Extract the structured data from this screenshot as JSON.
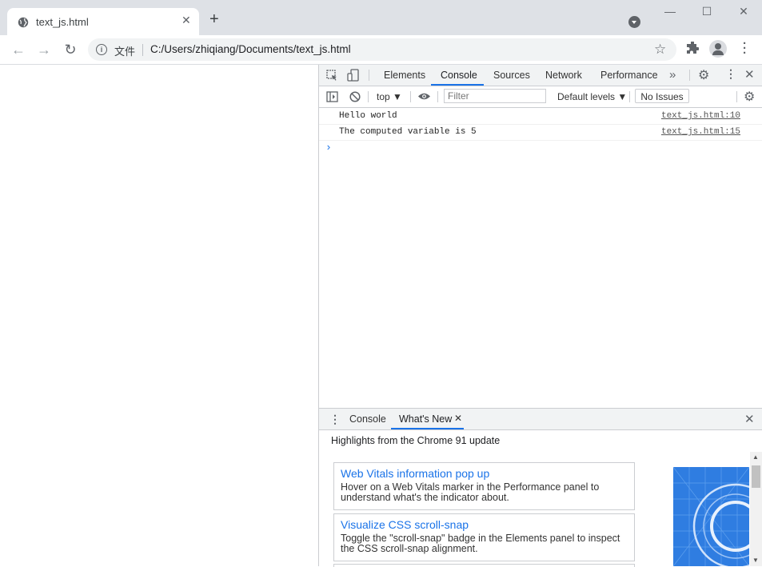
{
  "browser": {
    "tab_title": "text_js.html",
    "tab_close": "✕",
    "new_tab": "+",
    "window_controls": {
      "minimize": "—",
      "maximize": "☐",
      "close": "✕"
    },
    "omnibox": {
      "chip": "文件",
      "url": "C:/Users/zhiqiang/Documents/text_js.html"
    }
  },
  "devtools": {
    "tabs": [
      "Elements",
      "Console",
      "Sources",
      "Network",
      "Performance"
    ],
    "more_tabs": "»",
    "active_tab": "Console",
    "console_toolbar": {
      "context": "top ▼",
      "filter_placeholder": "Filter",
      "levels": "Default levels ▼",
      "issues": "No Issues"
    },
    "messages": [
      {
        "text": "Hello world",
        "source": "text_js.html:10"
      },
      {
        "text": "The computed variable is 5",
        "source": "text_js.html:15"
      }
    ],
    "prompt": "›"
  },
  "drawer": {
    "tabs": [
      "Console",
      "What's New"
    ],
    "active_tab": "What's New",
    "tab_close": "✕",
    "close": "✕",
    "headline": "Highlights from the Chrome 91 update",
    "cards": [
      {
        "title": "Web Vitals information pop up",
        "description": "Hover on a Web Vitals marker in the Performance panel to understand what's the indicator about."
      },
      {
        "title": "Visualize CSS scroll-snap",
        "description": "Toggle the \"scroll-snap\" badge in the Elements panel to inspect the CSS scroll-snap alignment."
      }
    ]
  },
  "colors": {
    "accent": "#1a73e8",
    "chrome_frame": "#dee1e6",
    "devtools_bar": "#f1f3f4"
  }
}
